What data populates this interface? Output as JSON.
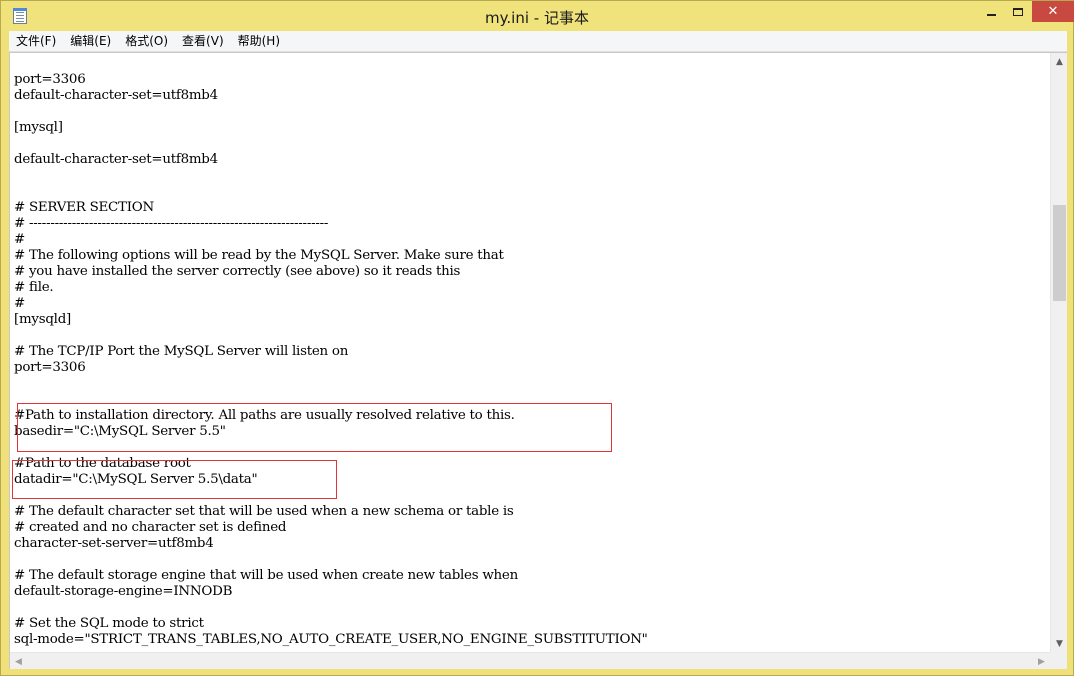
{
  "window": {
    "title": "my.ini - 记事本"
  },
  "menu": {
    "items": [
      {
        "name": "menu-file",
        "label": "文件(F)"
      },
      {
        "name": "menu-edit",
        "label": "编辑(E)"
      },
      {
        "name": "menu-format",
        "label": "格式(O)"
      },
      {
        "name": "menu-view",
        "label": "查看(V)"
      },
      {
        "name": "menu-help",
        "label": "帮助(H)"
      }
    ]
  },
  "editor": {
    "lines": [
      "port=3306",
      "default-character-set=utf8mb4",
      "",
      "[mysql]",
      "",
      "default-character-set=utf8mb4",
      "",
      "",
      "# SERVER SECTION",
      "# ----------------------------------------------------------------------",
      "#",
      "# The following options will be read by the MySQL Server. Make sure that",
      "# you have installed the server correctly (see above) so it reads this",
      "# file.",
      "#",
      "[mysqld]",
      "",
      "# The TCP/IP Port the MySQL Server will listen on",
      "port=3306",
      "",
      "",
      "#Path to installation directory. All paths are usually resolved relative to this.",
      "basedir=\"C:\\MySQL Server 5.5\"",
      "",
      "#Path to the database root",
      "datadir=\"C:\\MySQL Server 5.5\\data\"",
      "",
      "# The default character set that will be used when a new schema or table is",
      "# created and no character set is defined",
      "character-set-server=utf8mb4",
      "",
      "# The default storage engine that will be used when create new tables when",
      "default-storage-engine=INNODB",
      "",
      "# Set the SQL mode to strict",
      "sql-mode=\"STRICT_TRANS_TABLES,NO_AUTO_CREATE_USER,NO_ENGINE_SUBSTITUTION\""
    ]
  },
  "colors": {
    "titlebar": "#f1e37b",
    "close_button": "#c7493f",
    "highlight_box": "#e0363a"
  },
  "icons": {
    "app": "notepad-icon",
    "minimize": "minimize-icon",
    "maximize": "maximize-icon",
    "close": "close-icon"
  }
}
